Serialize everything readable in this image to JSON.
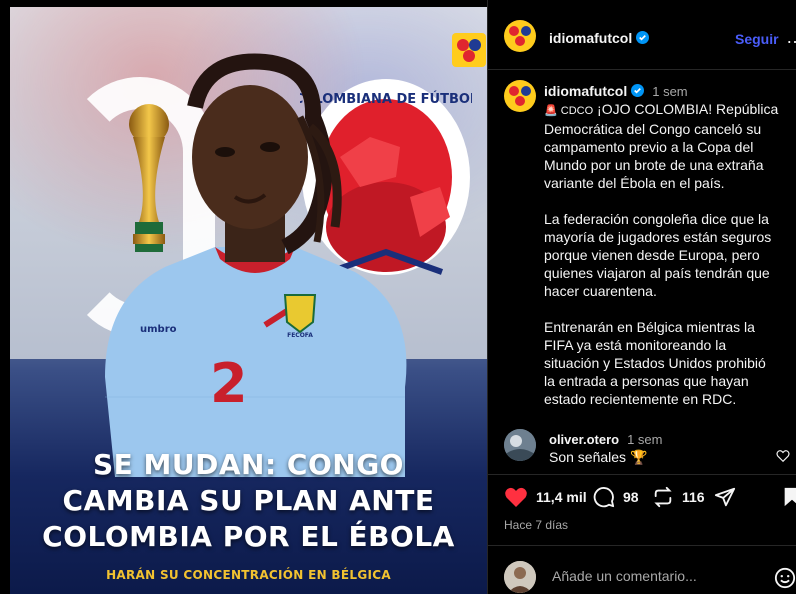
{
  "post": {
    "headline_lines": [
      "SE MUDAN: CONGO",
      "CAMBIA SU PLAN ANTE",
      "COLOMBIA POR EL ÉBOLA"
    ],
    "subline": "HARÁN SU CONCENTRACIÓN EN BÉLGICA",
    "badge_text": "COLOMBIANA DE FÚTBOL",
    "jersey_number": "2",
    "jersey_brand": "umbro",
    "crest_text": "FECOFA"
  },
  "header": {
    "username": "idiomafutcol",
    "follow_label": "Seguir",
    "more_label": "…"
  },
  "caption": {
    "username": "idiomafutcol",
    "time": "1 sem",
    "prefix": "🚨 CDCO",
    "text": " ¡OJO COLOMBIA! República Democrática del Congo canceló su campamento previo a la Copa del Mundo por un brote de una extraña variante del Ébola en el país.\n\nLa federación congoleña dice que la mayoría de jugadores están seguros porque vienen desde Europa, pero quienes viajaron al país tendrán que hacer cuarentena.\n\nEntrenarán en Bélgica mientras la FIFA ya está monitoreando la situación y Estados Unidos prohibió la entrada a personas que hayan estado recientemente en RDC."
  },
  "comment": {
    "username": "oliver.otero",
    "time": "1 sem",
    "text": "Son señales 🏆"
  },
  "actions": {
    "likes": "11,4 mil",
    "comments": "98",
    "reposts": "116",
    "posted_ago": "Hace 7 días"
  },
  "add_comment": {
    "placeholder": "Añade un comentario..."
  },
  "colors": {
    "like_red": "#ff3040",
    "follow_blue": "#4a5df9",
    "brand_yellow": "#ffcc1d",
    "headline_yellow": "#f2c230"
  }
}
